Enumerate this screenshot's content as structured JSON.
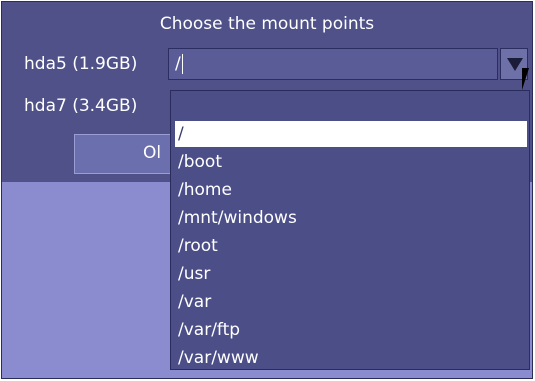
{
  "dialog": {
    "title": "Choose the mount points",
    "rows": [
      {
        "label": "hda5 (1.9GB)",
        "value": "/"
      },
      {
        "label": "hda7 (3.4GB)",
        "value": ""
      }
    ],
    "ok_label": "OK",
    "ok_visible_text": "Ol"
  },
  "dropdown": {
    "options": [
      "",
      "/",
      "/boot",
      "/home",
      "/mnt/windows",
      "/root",
      "/usr",
      "/var",
      "/var/ftp",
      "/var/www"
    ],
    "selected": "/"
  },
  "colors": {
    "dialog_bg": "#4f5188",
    "lower_area_bg": "#8a8ccf",
    "selected_bg": "#ffffff"
  }
}
